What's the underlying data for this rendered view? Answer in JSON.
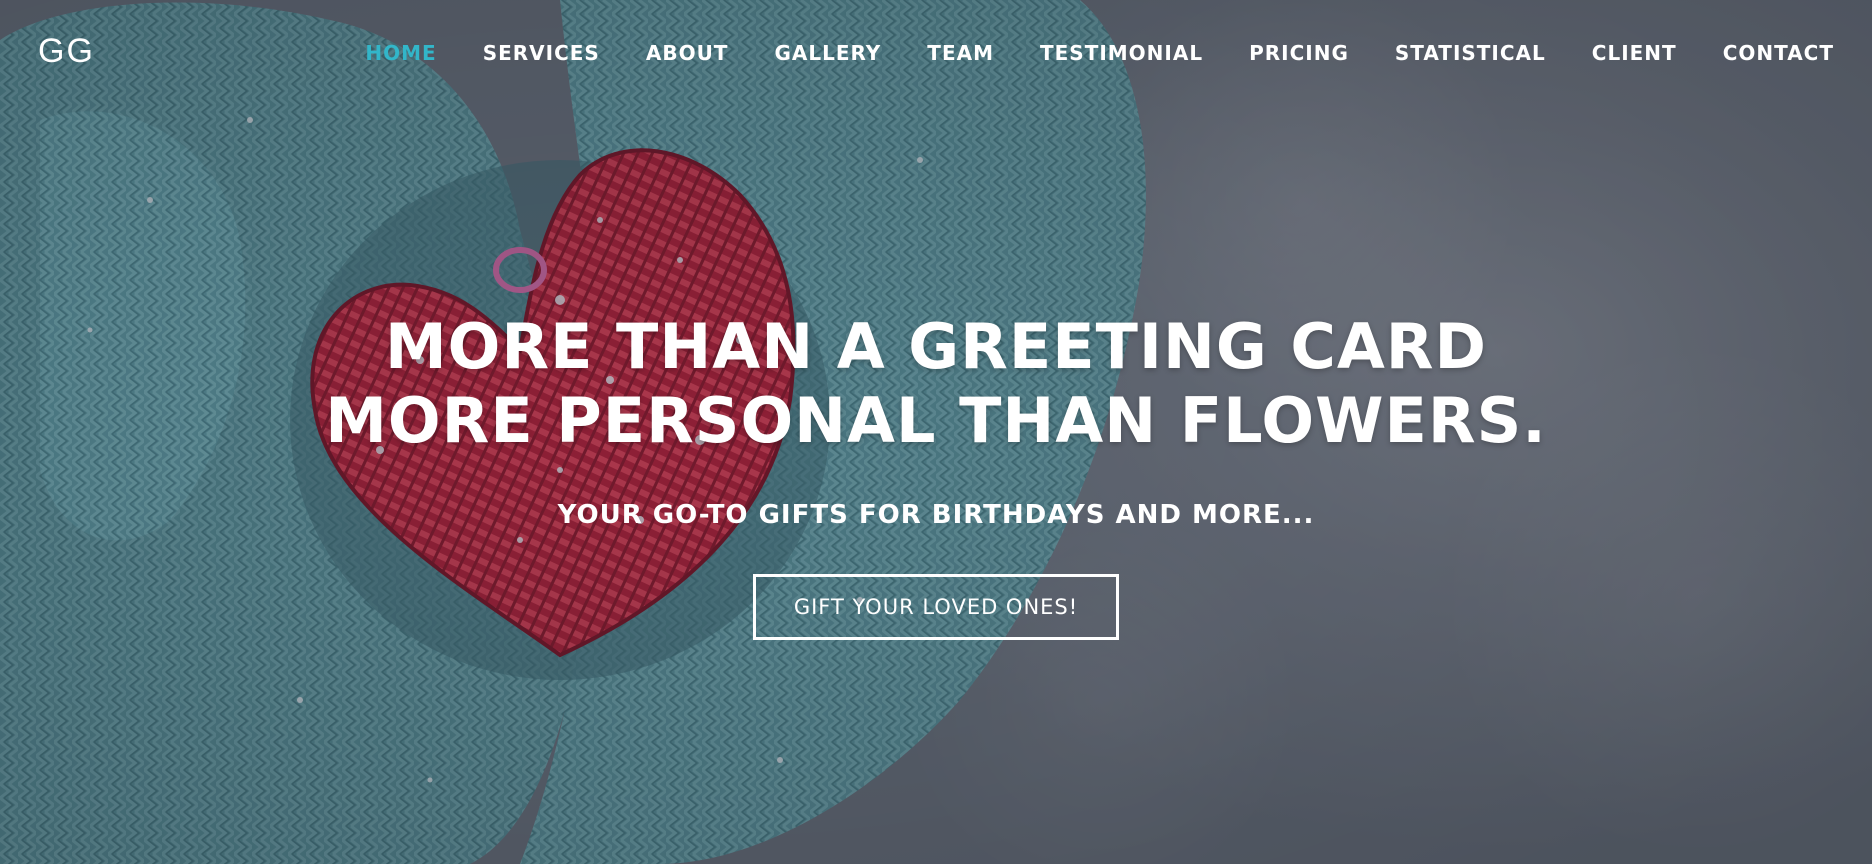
{
  "brand": {
    "logo_text": "GG"
  },
  "nav": {
    "items": [
      {
        "label": "HOME",
        "active": true
      },
      {
        "label": "SERVICES"
      },
      {
        "label": "ABOUT"
      },
      {
        "label": "GALLERY"
      },
      {
        "label": "TEAM"
      },
      {
        "label": "TESTIMONIAL"
      },
      {
        "label": "PRICING"
      },
      {
        "label": "STATISTICAL"
      },
      {
        "label": "CLIENT"
      },
      {
        "label": "CONTACT"
      }
    ]
  },
  "hero": {
    "headline_line1": "MORE THAN A GREETING CARD",
    "headline_line2": "MORE PERSONAL THAN FLOWERS.",
    "subheadline": "YOUR GO-TO GIFTS FOR BIRTHDAYS AND MORE...",
    "cta_label": "GIFT YOUR LOVED ONES!"
  },
  "colors": {
    "accent": "#32b6c9",
    "text": "#ffffff",
    "mitten": "#5e9ea6",
    "heart": "#c41f3a",
    "snow_bg": "#7c828d"
  }
}
